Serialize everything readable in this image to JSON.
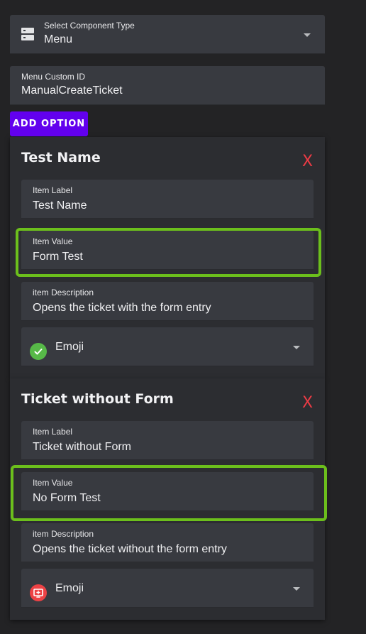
{
  "component_type": {
    "label": "Select Component Type",
    "value": "Menu",
    "icon": "server-icon"
  },
  "custom_id": {
    "label": "Menu Custom ID",
    "value": "ManualCreateTicket"
  },
  "add_option": {
    "label": "ADD OPTION"
  },
  "options": [
    {
      "title": "Test Name",
      "remove": "X",
      "item_label": {
        "label": "Item Label",
        "value": "Test Name"
      },
      "item_value": {
        "label": "Item Value",
        "value": "Form Test"
      },
      "item_description": {
        "label": "item Description",
        "value": "Opens the ticket with the form entry"
      },
      "emoji": {
        "label": "Emoji",
        "icon": "green-check-icon"
      }
    },
    {
      "title": "Ticket without Form",
      "remove": "X",
      "item_label": {
        "label": "Item Label",
        "value": "Ticket without Form"
      },
      "item_value": {
        "label": "Item Value",
        "value": "No Form Test"
      },
      "item_description": {
        "label": "item Description",
        "value": "Opens the ticket without the form entry"
      },
      "emoji": {
        "label": "Emoji",
        "icon": "red-ticket-icon"
      }
    }
  ],
  "colors": {
    "accent": "#6200ee",
    "highlight": "#6cbf1c",
    "remove": "#ed3b45",
    "field": "#383a40"
  }
}
